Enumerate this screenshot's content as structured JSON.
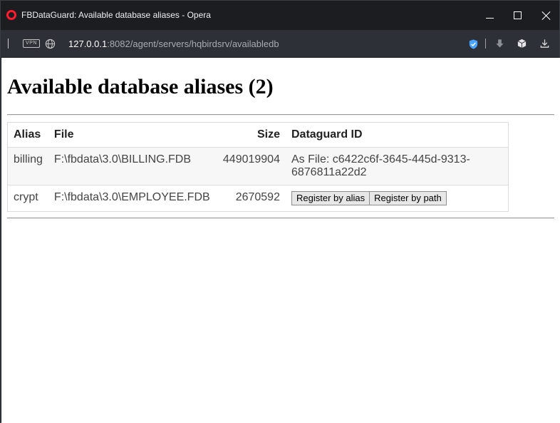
{
  "window": {
    "title": "FBDataGuard: Available database aliases - Opera"
  },
  "addressbar": {
    "vpn_label": "VPN",
    "url_host": "127.0.0.1",
    "url_rest": ":8082/agent/servers/hqbirdsrv/availabledb"
  },
  "page": {
    "title": "Available database aliases (2)",
    "table": {
      "headers": {
        "alias": "Alias",
        "file": "File",
        "size": "Size",
        "dataguard_id": "Dataguard ID"
      },
      "rows": [
        {
          "alias": "billing",
          "file": "F:\\fbdata\\3.0\\BILLING.FDB",
          "size": "449019904",
          "dataguard_id": "As File: c6422c6f-3645-445d-9313-6876811a22d2"
        },
        {
          "alias": "crypt",
          "file": "F:\\fbdata\\3.0\\EMPLOYEE.FDB",
          "size": "2670592",
          "register_alias_label": "Register by alias",
          "register_path_label": "Register by path"
        }
      ]
    }
  },
  "colors": {
    "titlebar_bg": "#1b1d21",
    "addressbar_bg": "#2d3037",
    "opera_red": "#ff1b2d",
    "shield_blue": "#4aa3ff"
  }
}
